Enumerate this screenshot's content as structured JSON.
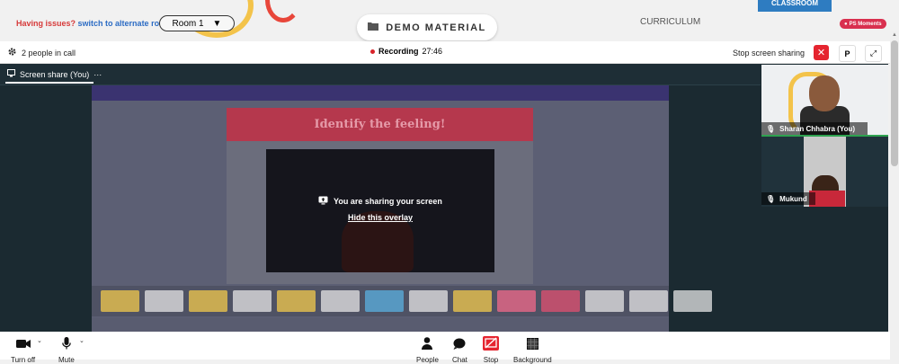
{
  "top": {
    "issues_prefix": "Having issues?",
    "issues_link": "switch to alternate room",
    "room_select": "Room 1",
    "demo_button": "DEMO MATERIAL",
    "curriculum": "CURRICULUM",
    "classroom_tab": "CLASSROOM",
    "ps_moments": "PS Moments"
  },
  "call": {
    "people_count": "2 people in call",
    "recording_label": "Recording",
    "recording_time": "27:46",
    "stop_sharing": "Stop screen sharing",
    "p_button": "P"
  },
  "share": {
    "tab_label": "Screen share (You)",
    "more": "···",
    "slide_title": "Identify the feeling!",
    "overlay_text": "You are sharing your screen",
    "overlay_link": "Hide this overlay"
  },
  "participants": [
    {
      "name": "Sharan Chhabra (You)"
    },
    {
      "name": "Mukund"
    }
  ],
  "toolbar": {
    "turn_off": "Turn off",
    "mute": "Mute",
    "people": "People",
    "chat": "Chat",
    "stop": "Stop",
    "background": "Background"
  },
  "colors": {
    "accent_red": "#e5242f",
    "classroom_blue": "#2e7cc1",
    "slide_header": "#b5384d",
    "stage_bg": "#1b2a31"
  },
  "thumbnails": [
    "#f2c94c",
    "#e6e6e6",
    "#f2c94c",
    "#e6e6e6",
    "#f2c94c",
    "#e6e6e6",
    "#5ab0e0",
    "#e6e6e6",
    "#f2c94c",
    "#f06a8a",
    "#e05070",
    "#e6e6e6",
    "#e6e6e6",
    "#e6e6e6"
  ]
}
